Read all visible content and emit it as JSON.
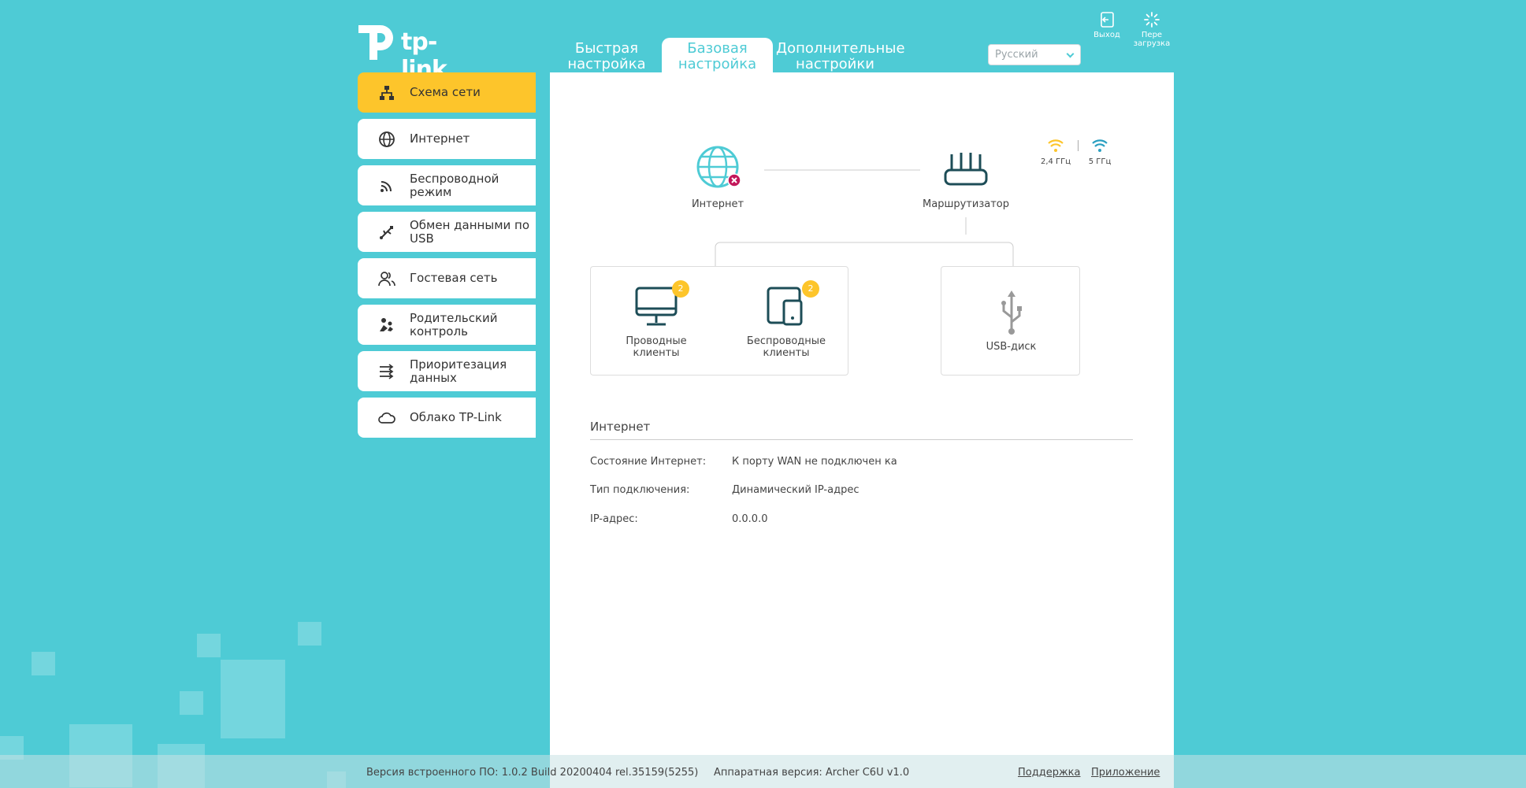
{
  "brand": {
    "logo_text": "tp-link"
  },
  "tabs": [
    {
      "line1": "Быстрая",
      "line2": "настройка"
    },
    {
      "line1": "Базовая",
      "line2": "настройка"
    },
    {
      "line1": "Дополнительные",
      "line2": "настройки"
    }
  ],
  "language": {
    "selected": "Русский"
  },
  "top_buttons": {
    "logout": "Выход",
    "reboot_line1": "Пере",
    "reboot_line2": "загрузка"
  },
  "sidebar": {
    "items": [
      {
        "label": "Схема сети",
        "icon": "network-map-icon",
        "active": true
      },
      {
        "label": "Интернет",
        "icon": "globe-icon"
      },
      {
        "label": "Беспроводной режим",
        "icon": "wireless-icon"
      },
      {
        "label": "Обмен данными по USB",
        "icon": "usb-icon"
      },
      {
        "label": "Гостевая сеть",
        "icon": "guests-icon"
      },
      {
        "label": "Родительский контроль",
        "icon": "parental-control-icon"
      },
      {
        "label": "Приоритезация данных",
        "icon": "priority-icon"
      },
      {
        "label": "Облако TP-Link",
        "icon": "cloud-icon"
      }
    ]
  },
  "map": {
    "internet_label": "Интернет",
    "router_label": "Маршрутизатор",
    "band_24": "2,4 ГГц",
    "band_5": "5 ГГц",
    "wired_label_1": "Проводные",
    "wired_label_2": "клиенты",
    "wired_count": "2",
    "wireless_label_1": "Беспроводные",
    "wireless_label_2": "клиенты",
    "wireless_count": "2",
    "usb_label": "USB-диск"
  },
  "internet_info": {
    "title": "Интернет",
    "rows": [
      {
        "label": "Состояние Интернет:",
        "value": "К порту WAN не подключен ка"
      },
      {
        "label": "Тип подключения:",
        "value": "Динамический IP-адрес"
      },
      {
        "label": "IP-адрес:",
        "value": "0.0.0.0"
      }
    ]
  },
  "footer": {
    "firmware": "Версия встроенного ПО: 1.0.2 Build 20200404 rel.35159(5255)",
    "hardware": "Аппаратная версия: Archer C6U v1.0",
    "support": "Поддержка",
    "app": "Приложение"
  },
  "colors": {
    "accent": "#4ecbd5",
    "active": "#fdc52b",
    "error": "#c2185b"
  }
}
